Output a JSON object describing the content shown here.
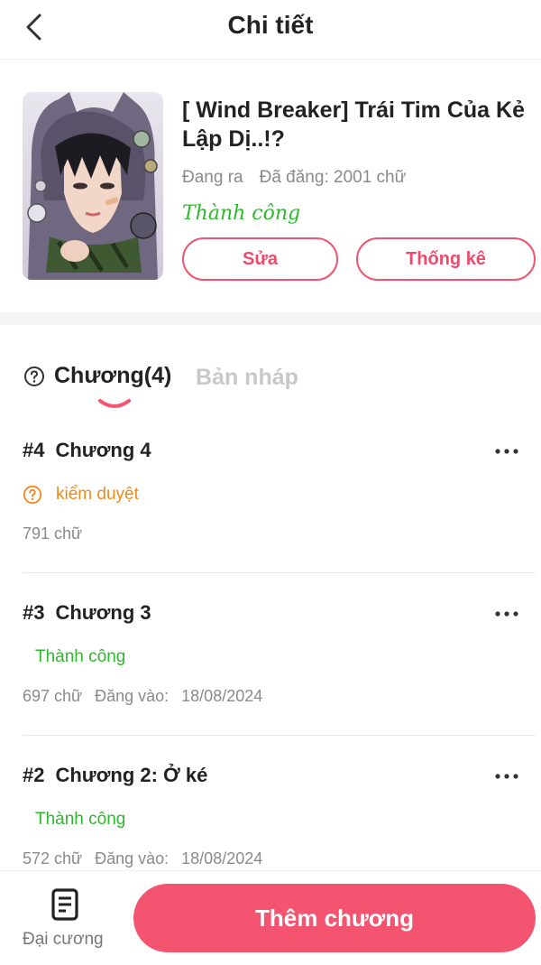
{
  "header": {
    "title": "Chi tiết",
    "back_icon": "chevron-left-icon"
  },
  "story": {
    "title": "[ Wind Breaker] Trái Tim Của Kẻ Lập Dị..!?",
    "publish_state": "Đang ra",
    "posted_words": "Đã đăng: 2001 chữ",
    "status": "Thành công",
    "edit_label": "Sửa",
    "stats_label": "Thống kê"
  },
  "tabs": {
    "chapters_label": "Chương(4)",
    "drafts_label": "Bản nháp",
    "active": "chapters"
  },
  "chapters": [
    {
      "num": "#4",
      "title": "Chương 4",
      "status": "kiểm duyệt",
      "status_type": "review",
      "words": "791 chữ",
      "date_label": "",
      "date": ""
    },
    {
      "num": "#3",
      "title": "Chương 3",
      "status": "Thành công",
      "status_type": "success",
      "words": "697 chữ",
      "date_label": "Đăng vào:",
      "date": "18/08/2024"
    },
    {
      "num": "#2",
      "title": "Chương 2: Ở ké",
      "status": "Thành công",
      "status_type": "success",
      "words": "572 chữ",
      "date_label": "Đăng vào:",
      "date": "18/08/2024"
    }
  ],
  "bottom": {
    "outline_label": "Đại cương",
    "outline_icon": "document-list-icon",
    "add_label": "Thêm chương"
  },
  "colors": {
    "accent": "#f4546f",
    "success": "#2eb82e",
    "review": "#f08a1c",
    "muted": "#8a8a8a"
  }
}
